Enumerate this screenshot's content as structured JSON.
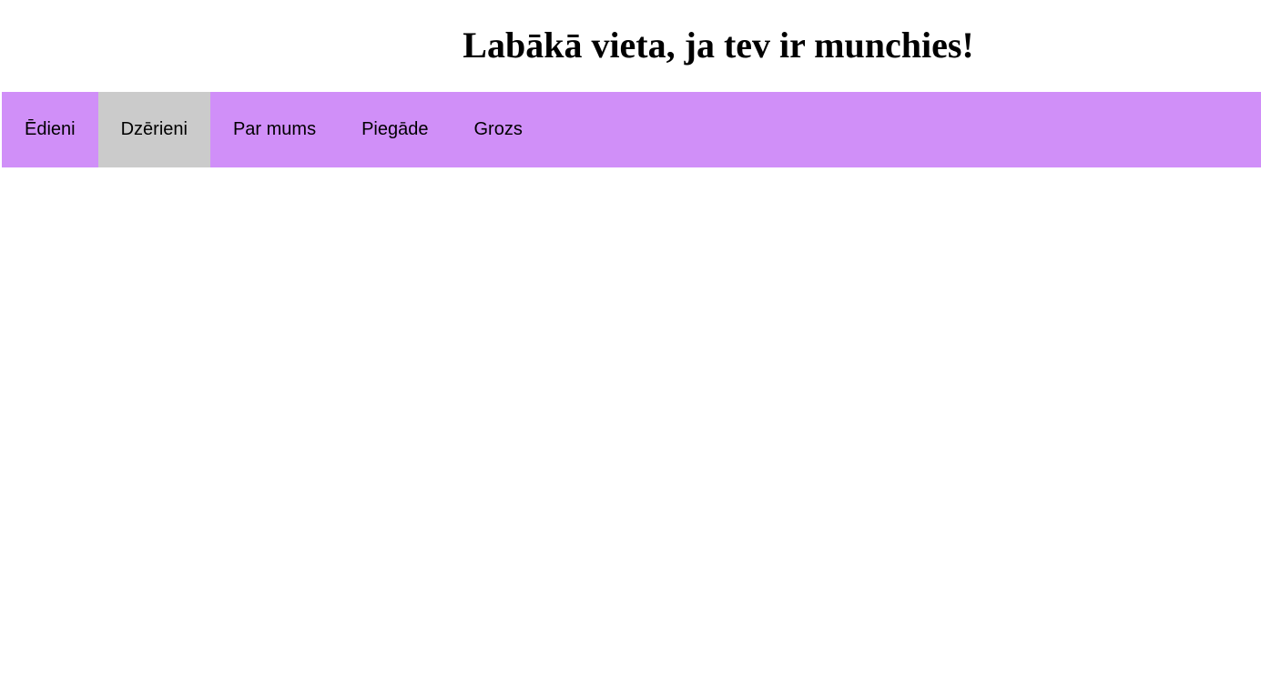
{
  "header": {
    "title": "Labākā vieta, ja tev ir munchies!"
  },
  "nav": {
    "items": [
      {
        "label": "Ēdieni"
      },
      {
        "label": "Dzērieni"
      },
      {
        "label": "Par mums"
      },
      {
        "label": "Piegāde"
      },
      {
        "label": "Grozs"
      }
    ],
    "active_index": 1
  },
  "colors": {
    "nav_background": "#d08ff8",
    "nav_active_background": "#cbcbcb",
    "page_background": "#ffffff",
    "text": "#000000"
  }
}
